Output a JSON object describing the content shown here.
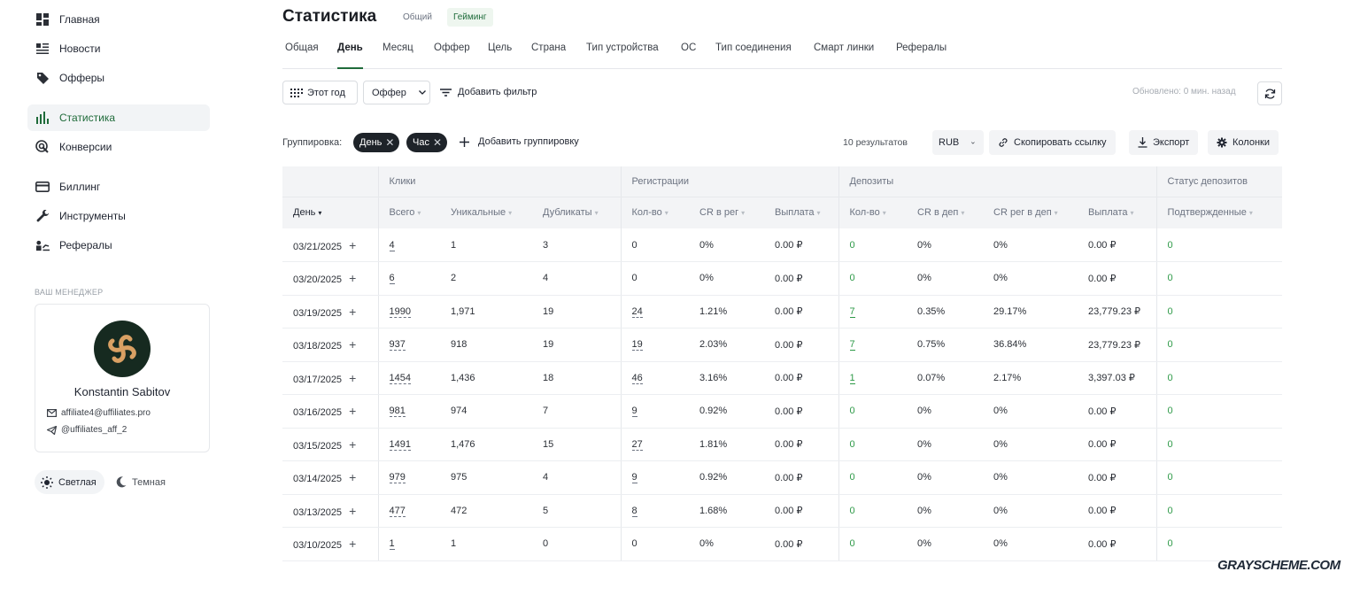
{
  "sidebar": {
    "nav": [
      {
        "label": "Главная",
        "icon": "dashboard-icon"
      },
      {
        "label": "Новости",
        "icon": "news-icon"
      },
      {
        "label": "Офферы",
        "icon": "tag-icon"
      },
      {
        "label": "Статистика",
        "icon": "bar-chart-icon",
        "active": true
      },
      {
        "label": "Конверсии",
        "icon": "conversions-icon"
      },
      {
        "label": "Биллинг",
        "icon": "card-icon"
      },
      {
        "label": "Инструменты",
        "icon": "wrench-icon"
      },
      {
        "label": "Рефералы",
        "icon": "referrals-icon"
      }
    ],
    "manager_title": "ВАШ МЕНЕДЖЕР",
    "manager": {
      "name": "Konstantin Sabitov",
      "email": "affiliate4@uffiliates.pro",
      "telegram": "@uffiliates_aff_2"
    },
    "theme": {
      "light": "Светлая",
      "dark": "Темная"
    }
  },
  "header": {
    "title": "Статистика",
    "mode_general": "Общий",
    "mode_gaming": "Гейминг"
  },
  "tabs": [
    "Общая",
    "День",
    "Месяц",
    "Оффер",
    "Цель",
    "Страна",
    "Тип устройства",
    "ОС",
    "Тип соединения",
    "Смарт линки",
    "Рефералы"
  ],
  "active_tab": "День",
  "filters": {
    "period": "Этот год",
    "offer": "Оффер",
    "add_filter": "Добавить фильтр",
    "updated": "Обновлено: 0 мин. назад"
  },
  "grouping": {
    "label": "Группировка:",
    "chips": [
      "День",
      "Час"
    ],
    "add": "Добавить группировку",
    "results": "10  результатов",
    "currency": "RUB",
    "copy_link": "Скопировать ссылку",
    "export": "Экспорт",
    "columns": "Колонки"
  },
  "table": {
    "groups": [
      "Клики",
      "Регистрации",
      "Депозиты",
      "Статус депозитов"
    ],
    "columns": [
      "День",
      "Всего",
      "Уникальные",
      "Дубликаты",
      "Кол-во",
      "CR в рег",
      "Выплата",
      "Кол-во",
      "CR в деп",
      "CR рег в деп",
      "Выплата",
      "Подтвержденные"
    ],
    "rows": [
      [
        "03/21/2025",
        "4",
        "1",
        "3",
        "0",
        "0%",
        "0.00 ₽",
        "0",
        "0%",
        "0%",
        "0.00 ₽",
        "0"
      ],
      [
        "03/20/2025",
        "6",
        "2",
        "4",
        "0",
        "0%",
        "0.00 ₽",
        "0",
        "0%",
        "0%",
        "0.00 ₽",
        "0"
      ],
      [
        "03/19/2025",
        "1990",
        "1,971",
        "19",
        "24",
        "1.21%",
        "0.00 ₽",
        "7",
        "0.35%",
        "29.17%",
        "23,779.23 ₽",
        "0"
      ],
      [
        "03/18/2025",
        "937",
        "918",
        "19",
        "19",
        "2.03%",
        "0.00 ₽",
        "7",
        "0.75%",
        "36.84%",
        "23,779.23 ₽",
        "0"
      ],
      [
        "03/17/2025",
        "1454",
        "1,436",
        "18",
        "46",
        "3.16%",
        "0.00 ₽",
        "1",
        "0.07%",
        "2.17%",
        "3,397.03 ₽",
        "0"
      ],
      [
        "03/16/2025",
        "981",
        "974",
        "7",
        "9",
        "0.92%",
        "0.00 ₽",
        "0",
        "0%",
        "0%",
        "0.00 ₽",
        "0"
      ],
      [
        "03/15/2025",
        "1491",
        "1,476",
        "15",
        "27",
        "1.81%",
        "0.00 ₽",
        "0",
        "0%",
        "0%",
        "0.00 ₽",
        "0"
      ],
      [
        "03/14/2025",
        "979",
        "975",
        "4",
        "9",
        "0.92%",
        "0.00 ₽",
        "0",
        "0%",
        "0%",
        "0.00 ₽",
        "0"
      ],
      [
        "03/13/2025",
        "477",
        "472",
        "5",
        "8",
        "1.68%",
        "0.00 ₽",
        "0",
        "0%",
        "0%",
        "0.00 ₽",
        "0"
      ],
      [
        "03/10/2025",
        "1",
        "1",
        "0",
        "0",
        "0%",
        "0.00 ₽",
        "0",
        "0%",
        "0%",
        "0.00 ₽",
        "0"
      ]
    ]
  },
  "watermark": "GRAYSCHEME.COM",
  "colors": {
    "accent_green": "#2e9a48",
    "chip_dark": "#1e2329",
    "header_bg": "#f3f4f6"
  }
}
